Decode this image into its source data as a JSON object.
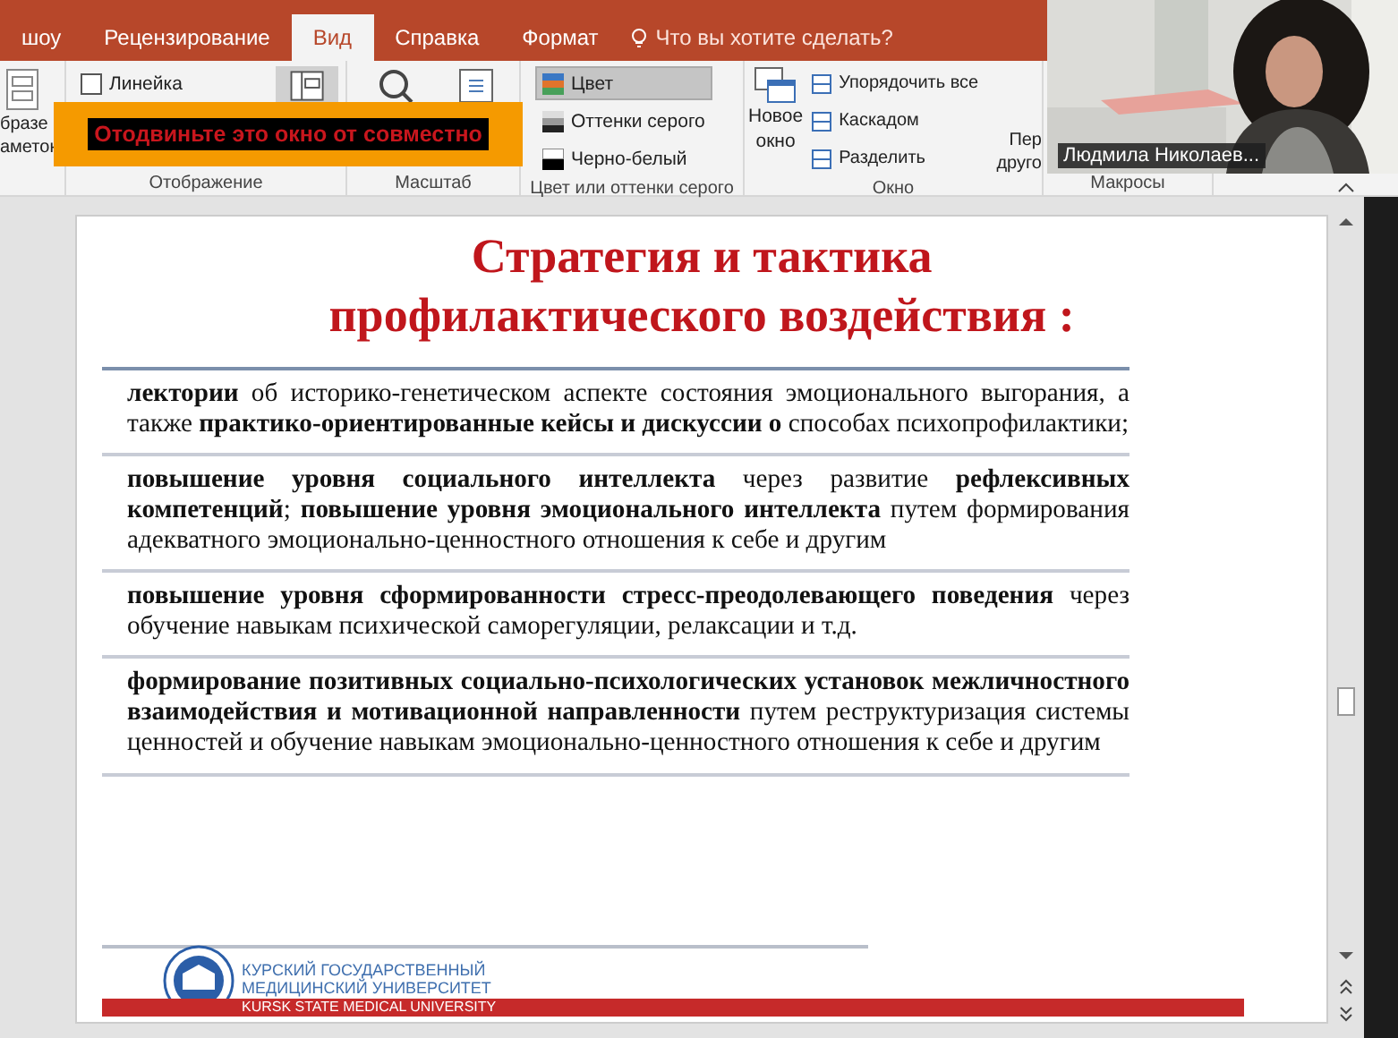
{
  "ribbon_tabs": [
    {
      "label": "шоу",
      "selected": false
    },
    {
      "label": "Рецензирование",
      "selected": false
    },
    {
      "label": "Вид",
      "selected": true
    },
    {
      "label": "Справка",
      "selected": false
    },
    {
      "label": "Формат",
      "selected": false
    }
  ],
  "tell_me": "Что вы хотите сделать?",
  "master_views": {
    "lines": [
      "бразе",
      "аметок"
    ]
  },
  "show_group": {
    "title": "Отображение",
    "ruler": {
      "label": "Линейка",
      "checked": false
    }
  },
  "zoom_group": {
    "title": "Масштаб"
  },
  "color_group": {
    "title": "Цвет или оттенки серого",
    "options": [
      {
        "label": "Цвет",
        "selected": true
      },
      {
        "label": "Оттенки серого",
        "selected": false
      },
      {
        "label": "Черно-белый",
        "selected": false
      }
    ]
  },
  "window_group": {
    "title": "Окно",
    "new_window": [
      "Новое",
      "окно"
    ],
    "commands": [
      "Упорядочить все",
      "Каскадом",
      "Разделить"
    ],
    "switch_lines": [
      "Пер",
      "друго"
    ]
  },
  "macros_group": {
    "title": "Макросы"
  },
  "share_warning": "Отодвиньте это окно от совместно",
  "video": {
    "kind": "picture",
    "name": "Людмила Николаев..."
  },
  "slide": {
    "title_lines": [
      "Стратегия и тактика",
      "профилактического воздействия :"
    ],
    "items": [
      "**лектории** об историко-генетическом аспекте состояния эмоционального выгорания, а также **практико-ориентированные кейсы и дискуссии о** способах психопрофилактики;",
      "**повышение уровня социального интеллекта** через развитие **рефлексивных компетенций**; **повышение уровня эмоционального интеллекта** путем формирования адекватного эмоционально-ценностного отношения к себе и другим",
      "**повышение уровня сформированности стресс-преодолевающего поведения** через обучение навыкам психической саморегуляции, релаксации и т.д.",
      "**формирование позитивных социально-психологических установок межличностного взаимодействия и мотивационной направленности** путем реструктуризация системы ценностей и обучение навыкам эмоционально-ценностного отношения к себе и другим"
    ],
    "footer": {
      "ru_lines": [
        "КУРСКИЙ ГОСУДАРСТВЕННЫЙ",
        "МЕДИЦИНСКИЙ УНИВЕРСИТЕТ"
      ],
      "en": "KURSK STATE MEDICAL UNIVERSITY"
    }
  }
}
